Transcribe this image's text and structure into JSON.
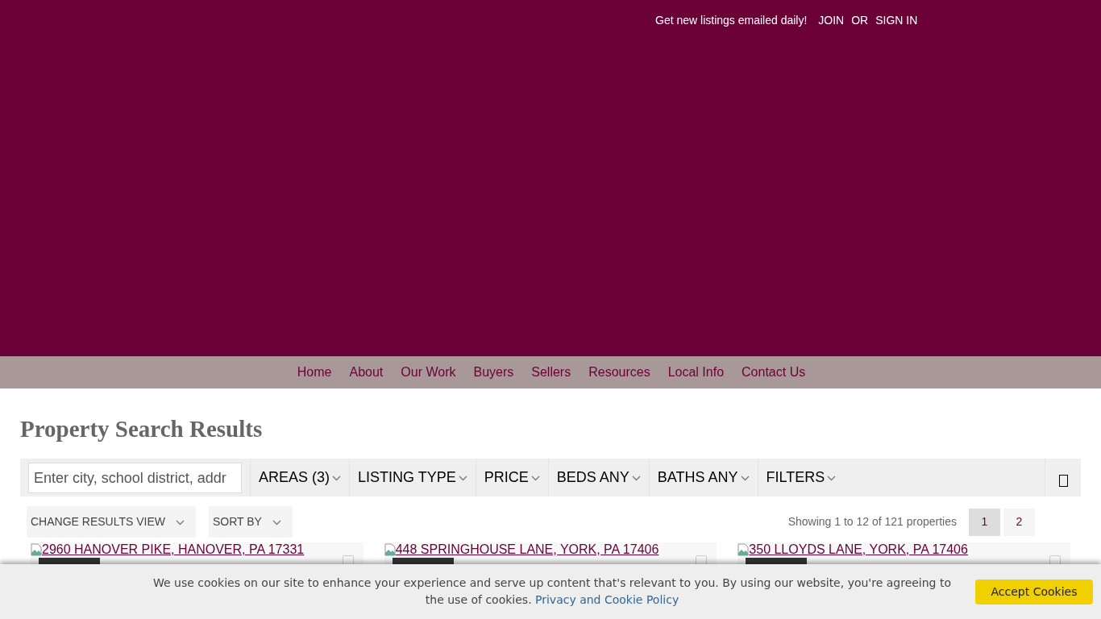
{
  "top_bar": {
    "promo": "Get new listings emailed daily!",
    "join": "JOIN",
    "or": "OR",
    "sign_in": "SIGN IN"
  },
  "nav": [
    "Home",
    "About",
    "Our Work",
    "Buyers",
    "Sellers",
    "Resources",
    "Local Info",
    "Contact Us"
  ],
  "title": "Property Search Results",
  "search": {
    "placeholder": "Enter city, school district, addr"
  },
  "filters": [
    "AREAS (3)",
    "LISTING TYPE",
    "PRICE",
    "BEDS ANY",
    "BATHS ANY",
    "FILTERS"
  ],
  "view_controls": [
    "CHANGE RESULTS VIEW",
    "SORT BY"
  ],
  "results_summary": "Showing 1 to 12 of 121 properties",
  "pages": [
    {
      "label": "1",
      "selected": true
    },
    {
      "label": "2",
      "selected": false
    }
  ],
  "listings": [
    {
      "address": "2960 HANOVER PIKE, HANOVER, PA 17331"
    },
    {
      "address": "448 SPRINGHOUSE LANE, YORK, PA 17406"
    },
    {
      "address": "350 LLOYDS LANE, YORK, PA 17406"
    }
  ],
  "cookie_banner": {
    "message": "We use cookies on our site to enhance your experience and serve up content that's relevant to you. By using our website, you're agreeing to the use of cookies.",
    "policy_link": "Privacy and Cookie Policy",
    "accept": "Accept Cookies"
  }
}
